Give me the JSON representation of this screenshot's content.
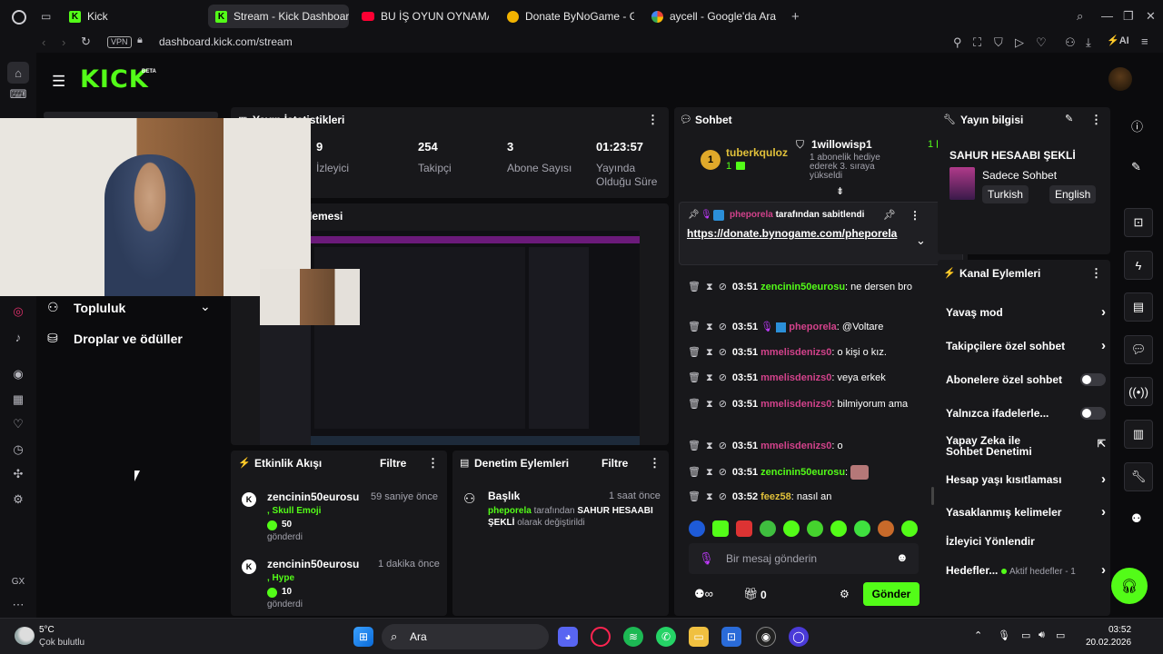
{
  "browser": {
    "tabs": [
      {
        "label": "Kick",
        "icon": "kick-favicon"
      },
      {
        "label": "Stream - Kick Dashboard",
        "icon": "kick-favicon"
      },
      {
        "label": "BU İŞ OYUN OYNAMAYA B",
        "icon": "youtube-favicon"
      },
      {
        "label": "Donate ByNoGame - Gele",
        "icon": "donate-favicon"
      },
      {
        "label": "aycell - Google'da Ara",
        "icon": "google-favicon"
      }
    ],
    "new_tab": "+",
    "vpn": "VPN",
    "url": "dashboard.kick.com/stream",
    "ai_label": "AI"
  },
  "kick": {
    "logo": "KICK",
    "logo_badge": "BETA"
  },
  "stats": {
    "title": "Yayın İstatistikleri",
    "items": [
      {
        "value": "9",
        "label": "İzleyici"
      },
      {
        "value": "254",
        "label": "Takipçi"
      },
      {
        "value": "3",
        "label": "Abone Sayısı"
      },
      {
        "value": "01:23:57",
        "label": "Yayında Olduğu Süre"
      }
    ]
  },
  "preview": {
    "title_fragment": "lemesi"
  },
  "sidebar_menu": [
    {
      "label": "Topluluk",
      "icon": "community-icon"
    },
    {
      "label": "Droplar ve ödüller",
      "icon": "drops-icon"
    }
  ],
  "activity": {
    "title": "Etkinlik Akışı",
    "filter": "Filtre",
    "items": [
      {
        "user": "zencinin50eurosu",
        "time": "59 saniye önce",
        "item": ", Skull Emoji",
        "amount": "50",
        "sent": "gönderdi"
      },
      {
        "user": "zencinin50eurosu",
        "time": "1 dakika önce",
        "item": ", Hype",
        "amount": "10",
        "sent": "gönderdi"
      }
    ]
  },
  "moderation": {
    "title": "Denetim Eylemleri",
    "filter": "Filtre",
    "item": {
      "heading": "Başlık",
      "time": "1 saat önce",
      "user": "pheporela",
      "text1": " tarafından ",
      "title_value": "SAHUR HESAABI ŞEKLİ",
      "text2": " olarak değiştirildi"
    }
  },
  "chat": {
    "title": "Sohbet",
    "leaderboard": [
      {
        "rank": "1",
        "user": "tuberkquloz",
        "count": "1"
      },
      {
        "user": "1willowisp1",
        "count": "1",
        "note": "1 abonelik hediye ederek 3. sıraya yükseldi"
      }
    ],
    "pinned": {
      "by_user": "pheporela",
      "by_text": "tarafından sabitlendi",
      "link": "https://donate.bynogame.com/pheporela"
    },
    "messages": [
      {
        "time": "03:51",
        "user": "zencinin50eurosu",
        "text": ": ne dersen bro",
        "color": "green"
      },
      {
        "time": "03:51",
        "user": "pheporela",
        "text": ": @Voltare",
        "color": "pink"
      },
      {
        "time": "03:51",
        "user": "mmelisdenizs0",
        "text": ": o kişi o kız.",
        "color": "pink"
      },
      {
        "time": "03:51",
        "user": "mmelisdenizs0",
        "text": ": veya erkek",
        "color": "pink"
      },
      {
        "time": "03:51",
        "user": "mmelisdenizs0",
        "text": ": bilmiyorum ama",
        "color": "pink"
      },
      {
        "time": "03:51",
        "user": "mmelisdenizs0",
        "text": ": o",
        "color": "pink"
      },
      {
        "time": "03:51",
        "user": "zencinin50eurosu",
        "text": ":",
        "color": "green"
      },
      {
        "time": "03:52",
        "user": "feez58",
        "text": ": nasıl an",
        "color": "yellow"
      }
    ],
    "input_placeholder": "Bir mesaj gönderin",
    "points": "0",
    "send": "Gönder"
  },
  "stream_info": {
    "title": "Yayın bilgisi",
    "stream_title": "SAHUR HESAABI ŞEKLİ",
    "category": "Sadece Sohbet",
    "tags": [
      "Turkish",
      "English"
    ]
  },
  "channel_actions": {
    "title": "Kanal Eylemleri",
    "items": [
      {
        "label": "Yavaş mod",
        "type": "chevron"
      },
      {
        "label": "Takipçilere özel sohbet",
        "type": "chevron"
      },
      {
        "label": "Abonelere özel sohbet",
        "type": "toggle"
      },
      {
        "label": "Yalnızca ifadelerle...",
        "type": "toggle"
      },
      {
        "label": "Yapay Zeka ile Sohbet Denetimi",
        "type": "external"
      },
      {
        "label": "Hesap yaşı kısıtlaması",
        "type": "chevron"
      },
      {
        "label": "Yasaklanmış kelimeler",
        "type": "chevron"
      },
      {
        "label": "İzleyici Yönlendir",
        "type": "none"
      },
      {
        "label": "Hedefler...",
        "type": "chevron",
        "extra": "Aktif hedefler - 1"
      }
    ]
  },
  "taskbar": {
    "weather_temp": "5°C",
    "weather_desc": "Çok bulutlu",
    "search": "Ara",
    "time": "03:52",
    "date": "20.02.2026"
  },
  "colors": {
    "kick_green": "#53fc18",
    "panel": "#18181b",
    "bg": "#0b0b0d",
    "pink": "#d2428b"
  }
}
